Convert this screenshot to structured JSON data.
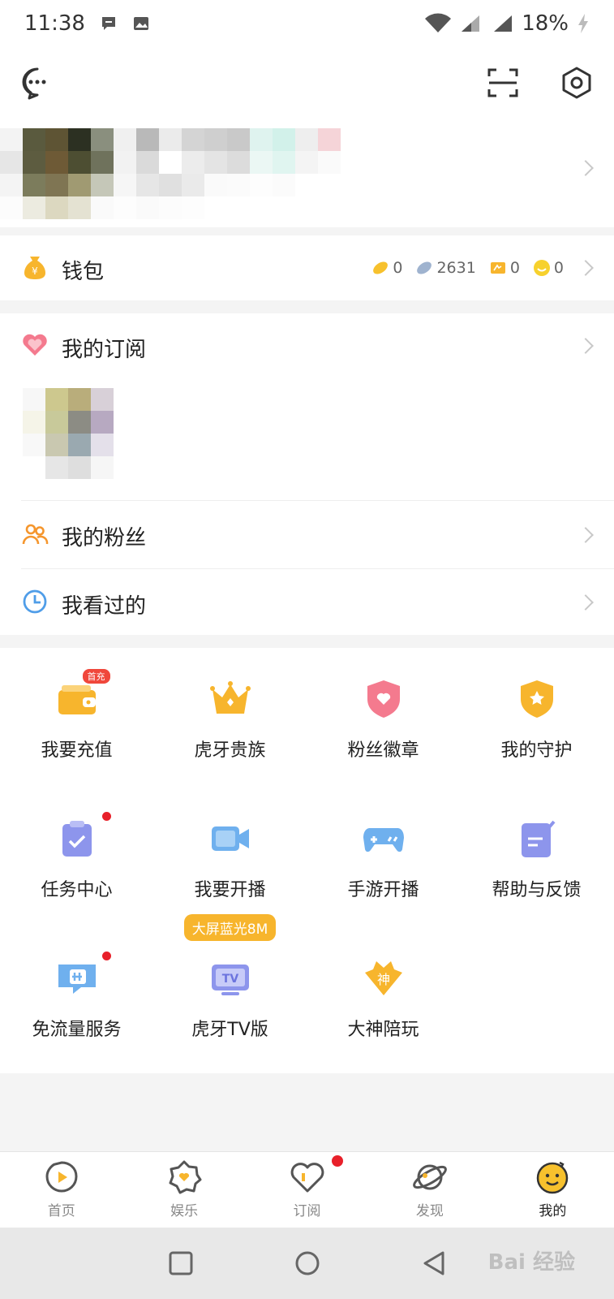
{
  "status_bar": {
    "time": "11:38",
    "battery": "18%"
  },
  "wallet": {
    "label": "钱包",
    "stats": [
      "0",
      "2631",
      "0",
      "0"
    ]
  },
  "subscriptions": {
    "label": "我的订阅"
  },
  "fans": {
    "label": "我的粉丝"
  },
  "history": {
    "label": "我看过的"
  },
  "grid": [
    {
      "label": "我要充值",
      "badge": "首充"
    },
    {
      "label": "虎牙贵族"
    },
    {
      "label": "粉丝徽章"
    },
    {
      "label": "我的守护"
    },
    {
      "label": "任务中心"
    },
    {
      "label": "我要开播"
    },
    {
      "label": "手游开播"
    },
    {
      "label": "帮助与反馈"
    },
    {
      "label": "免流量服务"
    },
    {
      "label": "虎牙TV版",
      "promo": "大屏蓝光8M"
    },
    {
      "label": "大神陪玩"
    }
  ],
  "tabs": [
    {
      "label": "首页",
      "icon": "home-icon"
    },
    {
      "label": "娱乐",
      "icon": "entertainment-icon"
    },
    {
      "label": "订阅",
      "icon": "subscribe-icon"
    },
    {
      "label": "发现",
      "icon": "discover-icon"
    },
    {
      "label": "我的",
      "icon": "me-icon"
    }
  ],
  "watermark": "Bai 经验",
  "colors": {
    "accent": "#f7b52d",
    "badge": "#f0473b",
    "dot": "#e8202a",
    "icon_blue": "#6fb0ee",
    "icon_pink": "#f47a8e"
  }
}
